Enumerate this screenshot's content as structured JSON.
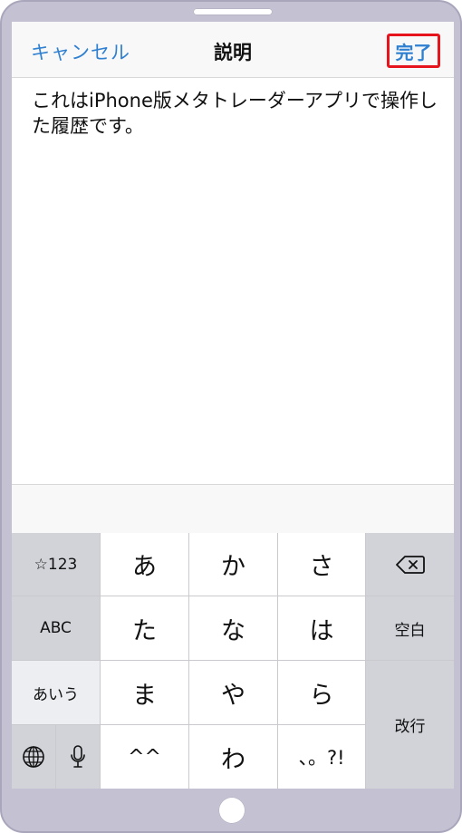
{
  "navbar": {
    "cancel_label": "キャンセル",
    "title": "説明",
    "done_label": "完了"
  },
  "note": {
    "text": "これはiPhone版メタトレーダーアプリで操作した履歴です。"
  },
  "keyboard": {
    "mode_numbers": "☆123",
    "mode_abc": "ABC",
    "mode_kana": "あいう",
    "space": "空白",
    "return": "改行",
    "keys": {
      "a": "あ",
      "ka": "か",
      "sa": "さ",
      "ta": "た",
      "na": "な",
      "ha": "は",
      "ma": "ま",
      "ya": "や",
      "ra": "ら",
      "dakuten": "^^",
      "wa": "わ",
      "punct": "、。?!"
    }
  },
  "colors": {
    "accent": "#2f80d1",
    "highlight": "#e6141d",
    "device_frame": "#c4c1d3"
  },
  "icons": {
    "backspace": "delete-left-icon",
    "globe": "globe-icon",
    "mic": "microphone-icon"
  }
}
